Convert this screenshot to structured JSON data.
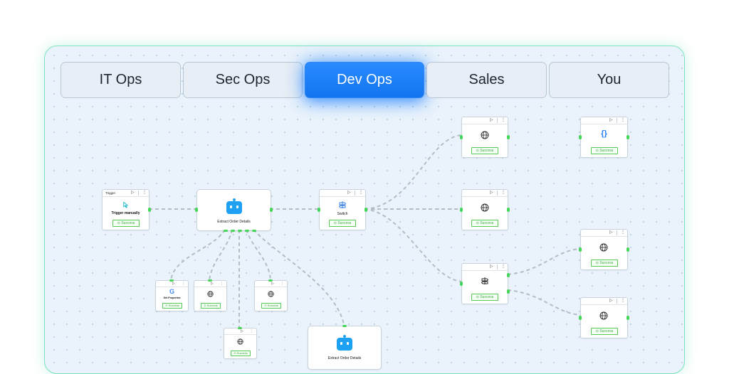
{
  "tabs": [
    {
      "label": "IT Ops"
    },
    {
      "label": "Sec Ops"
    },
    {
      "label": "Dev Ops",
      "active": true
    },
    {
      "label": "Sales"
    },
    {
      "label": "You"
    }
  ],
  "nodes": {
    "trigger": {
      "header": "Trigger",
      "title": "Trigger manually",
      "status": "Success"
    },
    "extract": {
      "title": "Extract Order Details"
    },
    "switch": {
      "title": "Switch",
      "status": "Success"
    },
    "get_properties": {
      "title": "Get Properties",
      "status": "Success"
    },
    "http_a": {
      "status": "Success"
    },
    "http_b": {
      "status": "Success"
    },
    "http_c": {
      "status": "Success"
    },
    "top_http": {
      "status": "Success"
    },
    "mid_http": {
      "status": "Success"
    },
    "switch2": {
      "status": "Success"
    },
    "code": {
      "status": "Success"
    },
    "right_http1": {
      "status": "Success"
    },
    "right_http2": {
      "status": "Success"
    },
    "extract2": {
      "title": "Extract Order Details"
    }
  },
  "icons": {
    "play": "▷",
    "more": "⋮",
    "globe": "globe-icon",
    "code": "{}",
    "google": "G"
  },
  "colors": {
    "accent": "#1e7df5",
    "success": "#45d65a",
    "frame": "#7fe3c2",
    "bot": "#1ea1f2"
  }
}
